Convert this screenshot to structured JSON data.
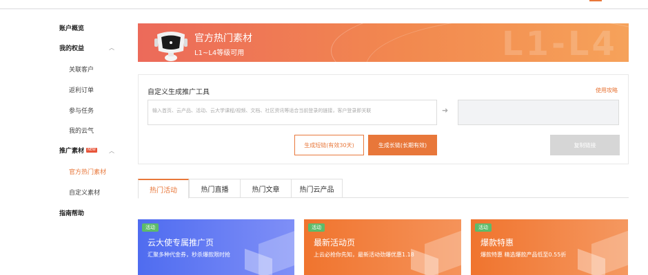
{
  "sidebar": {
    "overview": "账户概览",
    "my_rights": "我的权益",
    "related_customers": "关联客户",
    "rebate_orders": "返利订单",
    "join_tasks": "参与任务",
    "my_cloud": "我的云气",
    "promo_material": "推广素材",
    "new_badge": "NEW",
    "official_material": "官方热门素材",
    "custom_material": "自定义素材",
    "guide_help": "指南帮助"
  },
  "banner": {
    "title": "官方热门素材",
    "subtitle": "L1~L4等级可用",
    "watermark": "L1-L4"
  },
  "tool": {
    "title": "自定义生成推广工具",
    "help_link": "使用攻略",
    "input_placeholder": "输入首页、云产品、活动、云大学课程/视频、文档、社区资讯等适合当前登录的链接，客户登录即关联",
    "short_link_btn": "生成短链(有效30天)",
    "long_link_btn": "生成长链(长期有效)",
    "copy_btn": "复制链接"
  },
  "tabs": [
    "热门活动",
    "热门直播",
    "热门文章",
    "热门云产品"
  ],
  "cards": [
    {
      "tag": "活动",
      "title": "云大使专属推广页",
      "desc": "汇聚多种代金券，秒杀爆款限时抢",
      "color_from": "#4f6cf0",
      "color_to": "#7f8ff7"
    },
    {
      "tag": "活动",
      "title": "最新活动页",
      "desc": "上云必抢你先知，最新活动劲爆优惠1.18",
      "color_from": "#f0742e",
      "color_to": "#f5935a"
    },
    {
      "tag": "活动",
      "title": "爆款特惠",
      "desc": "爆款特惠 精选爆款产品低至0.55折",
      "color_from": "#f0742e",
      "color_to": "#f59860"
    }
  ],
  "colors": {
    "accent": "#e8773a",
    "tag_green": "#5dbb6a"
  }
}
